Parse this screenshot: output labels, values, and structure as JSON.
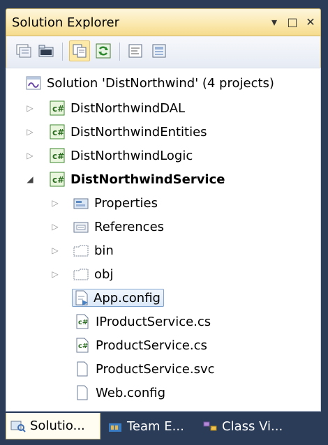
{
  "panel": {
    "title": "Solution Explorer",
    "controls": [
      "▾",
      "□",
      "✕"
    ]
  },
  "toolbar": {
    "buttons": [
      "properties",
      "show-all-files",
      "refresh",
      "view-code",
      "view-designer"
    ]
  },
  "tree": {
    "solution": "Solution 'DistNorthwind' (4 projects)",
    "projects": [
      "DistNorthwindDAL",
      "DistNorthwindEntities",
      "DistNorthwindLogic",
      "DistNorthwindService"
    ],
    "service_children": [
      "Properties",
      "References",
      "bin",
      "obj",
      "App.config",
      "IProductService.cs",
      "ProductService.cs",
      "ProductService.svc",
      "Web.config"
    ],
    "selected": "App.config"
  },
  "tabs": [
    {
      "label": "Solutio...",
      "active": true
    },
    {
      "label": "Team E...",
      "active": false
    },
    {
      "label": "Class Vi...",
      "active": false
    }
  ],
  "colors": {
    "frame": "#2b3c59",
    "title_bar": "#fbe9b0",
    "selection_border": "#7da2ce",
    "csharp_icon": "#3c8a2e"
  }
}
